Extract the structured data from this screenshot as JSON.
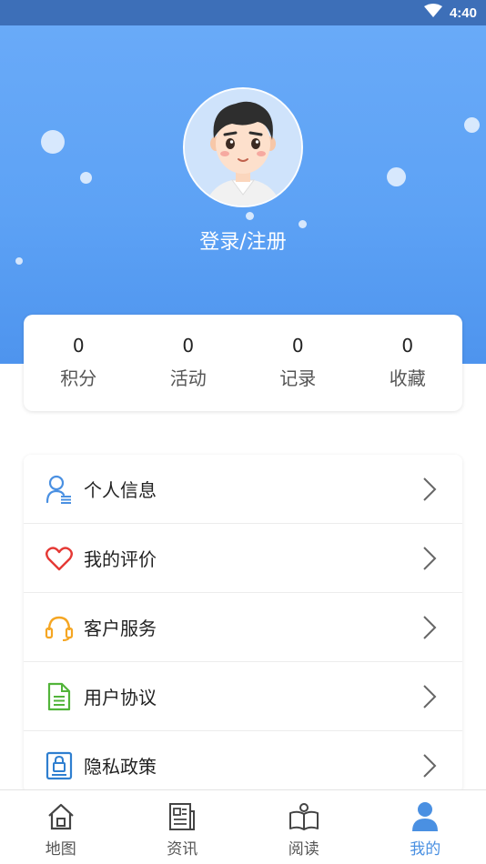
{
  "status_bar": {
    "time": "4:40"
  },
  "profile": {
    "login_label": "登录/注册"
  },
  "stats": [
    {
      "value": "0",
      "label": "积分"
    },
    {
      "value": "0",
      "label": "活动"
    },
    {
      "value": "0",
      "label": "记录"
    },
    {
      "value": "0",
      "label": "收藏"
    }
  ],
  "menu": [
    {
      "label": "个人信息",
      "icon": "user-info-icon"
    },
    {
      "label": "我的评价",
      "icon": "heart-icon"
    },
    {
      "label": "客户服务",
      "icon": "headset-icon"
    },
    {
      "label": "用户协议",
      "icon": "document-icon"
    },
    {
      "label": "隐私政策",
      "icon": "lock-document-icon"
    }
  ],
  "tabs": [
    {
      "label": "地图",
      "icon": "home-icon",
      "active": false
    },
    {
      "label": "资讯",
      "icon": "news-icon",
      "active": false
    },
    {
      "label": "阅读",
      "icon": "book-icon",
      "active": false
    },
    {
      "label": "我的",
      "icon": "person-icon",
      "active": true
    }
  ],
  "colors": {
    "header": "#5da2f5",
    "accent": "#4a90e2",
    "status_bar": "#3d6fb8"
  }
}
